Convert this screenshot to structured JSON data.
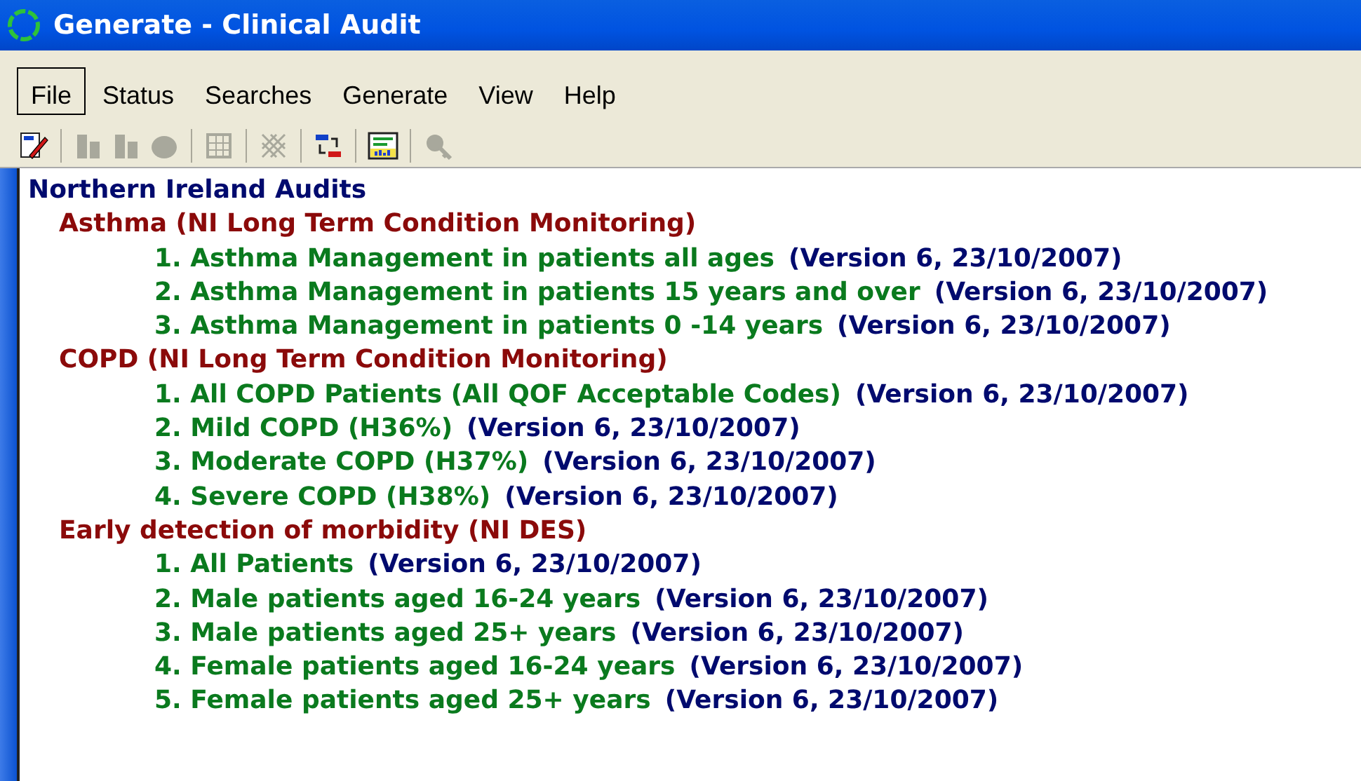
{
  "window": {
    "title": "Generate - Clinical Audit"
  },
  "menu": [
    {
      "label": "File",
      "selected": true
    },
    {
      "label": "Status",
      "selected": false
    },
    {
      "label": "Searches",
      "selected": false
    },
    {
      "label": "Generate",
      "selected": false
    },
    {
      "label": "View",
      "selected": false
    },
    {
      "label": "Help",
      "selected": false
    }
  ],
  "toolbar": [
    {
      "kind": "edit",
      "disabled": false
    },
    {
      "kind": "separator"
    },
    {
      "kind": "column",
      "disabled": true
    },
    {
      "kind": "column",
      "disabled": true
    },
    {
      "kind": "round",
      "disabled": true
    },
    {
      "kind": "separator"
    },
    {
      "kind": "grid",
      "disabled": true
    },
    {
      "kind": "separator"
    },
    {
      "kind": "hatch",
      "disabled": true
    },
    {
      "kind": "separator"
    },
    {
      "kind": "swap",
      "disabled": false
    },
    {
      "kind": "separator"
    },
    {
      "kind": "report",
      "disabled": false
    },
    {
      "kind": "separator"
    },
    {
      "kind": "key",
      "disabled": true
    }
  ],
  "tree": {
    "label": "Northern Ireland Audits",
    "children": [
      {
        "label": "Asthma (NI Long Term Condition Monitoring)",
        "children": [
          {
            "label": "1. Asthma Management in patients all ages",
            "version": "(Version 6, 23/10/2007)"
          },
          {
            "label": "2. Asthma Management in patients 15 years and over",
            "version": "(Version 6, 23/10/2007)"
          },
          {
            "label": "3. Asthma Management in patients 0 -14 years",
            "version": "(Version 6, 23/10/2007)"
          }
        ]
      },
      {
        "label": "COPD (NI Long Term Condition Monitoring)",
        "children": [
          {
            "label": "1. All COPD Patients (All QOF Acceptable Codes)",
            "version": "(Version 6, 23/10/2007)"
          },
          {
            "label": "2. Mild COPD (H36%)",
            "version": "(Version 6, 23/10/2007)"
          },
          {
            "label": "3. Moderate COPD (H37%)",
            "version": "(Version 6, 23/10/2007)"
          },
          {
            "label": "4. Severe COPD (H38%)",
            "version": "(Version 6, 23/10/2007)"
          }
        ]
      },
      {
        "label": "Early detection of morbidity (NI DES)",
        "children": [
          {
            "label": "1. All Patients",
            "version": "(Version 6, 23/10/2007)"
          },
          {
            "label": "2. Male patients aged 16-24 years",
            "version": "(Version 6, 23/10/2007)"
          },
          {
            "label": "3. Male patients aged 25+ years",
            "version": "(Version 6, 23/10/2007)"
          },
          {
            "label": "4. Female patients aged 16-24 years",
            "version": "(Version 6, 23/10/2007)"
          },
          {
            "label": "5. Female patients aged 25+ years",
            "version": "(Version 6, 23/10/2007)"
          }
        ]
      }
    ]
  }
}
